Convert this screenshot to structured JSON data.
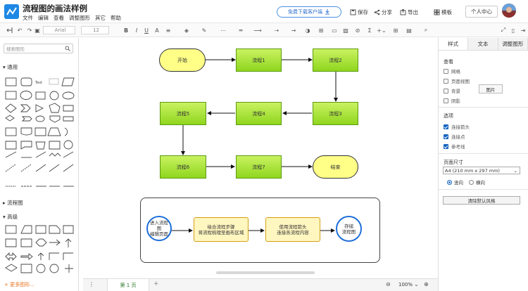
{
  "app": {
    "title": "流程图的画法样例",
    "menu": [
      "文件",
      "编辑",
      "查看",
      "调整图形",
      "其它",
      "帮助"
    ]
  },
  "header": {
    "download_label": "免费下载客户端",
    "save": "保存",
    "share": "分享",
    "export": "导出",
    "template": "模板",
    "personal": "个人中心"
  },
  "toolbar": {
    "font": "Arial",
    "size": "12"
  },
  "left": {
    "search_placeholder": "搜索图形",
    "sections": [
      "通用",
      "流程图",
      "高级"
    ],
    "more": "更多图形..."
  },
  "diagram": {
    "nodes": {
      "start": "开始",
      "p1": "流程1",
      "p2": "流程2",
      "p3": "流程3",
      "p4": "流程4",
      "p5": "流程5",
      "p6": "流程6",
      "p7": "流程7",
      "end": "结束"
    },
    "group": {
      "c1": [
        "进入流程图",
        "编辑页面"
      ],
      "b1": [
        "绘合流程步骤",
        "将流程梳理至画布区域"
      ],
      "b2": [
        "使用流程箭头",
        "连接各流程内容"
      ],
      "c2": [
        "存储",
        "流程图"
      ]
    }
  },
  "right": {
    "tabs": [
      "样式",
      "文本",
      "调整图形"
    ],
    "view_label": "查看",
    "view_options": [
      {
        "label": "网格",
        "checked": false
      },
      {
        "label": "页面视图",
        "checked": false
      },
      {
        "label": "背景",
        "checked": false
      },
      {
        "label": "阴影",
        "checked": false
      }
    ],
    "image_button": "图片",
    "options_label": "选项",
    "options": [
      {
        "label": "连接箭头",
        "checked": true
      },
      {
        "label": "连接点",
        "checked": true
      },
      {
        "label": "参考线",
        "checked": true
      }
    ],
    "page_size_label": "页面尺寸",
    "page_size": "A4 (210 mm x 297 mm)",
    "orientation": [
      "竖向",
      "横向"
    ],
    "clear_style": "清除默认风格"
  },
  "bottom": {
    "page_tab": "第 1 页",
    "zoom": "100%"
  },
  "colors": {
    "accent": "#1e88e5",
    "process": "#99dd22",
    "terminal": "#ffff88",
    "more_link": "#e8711a"
  }
}
